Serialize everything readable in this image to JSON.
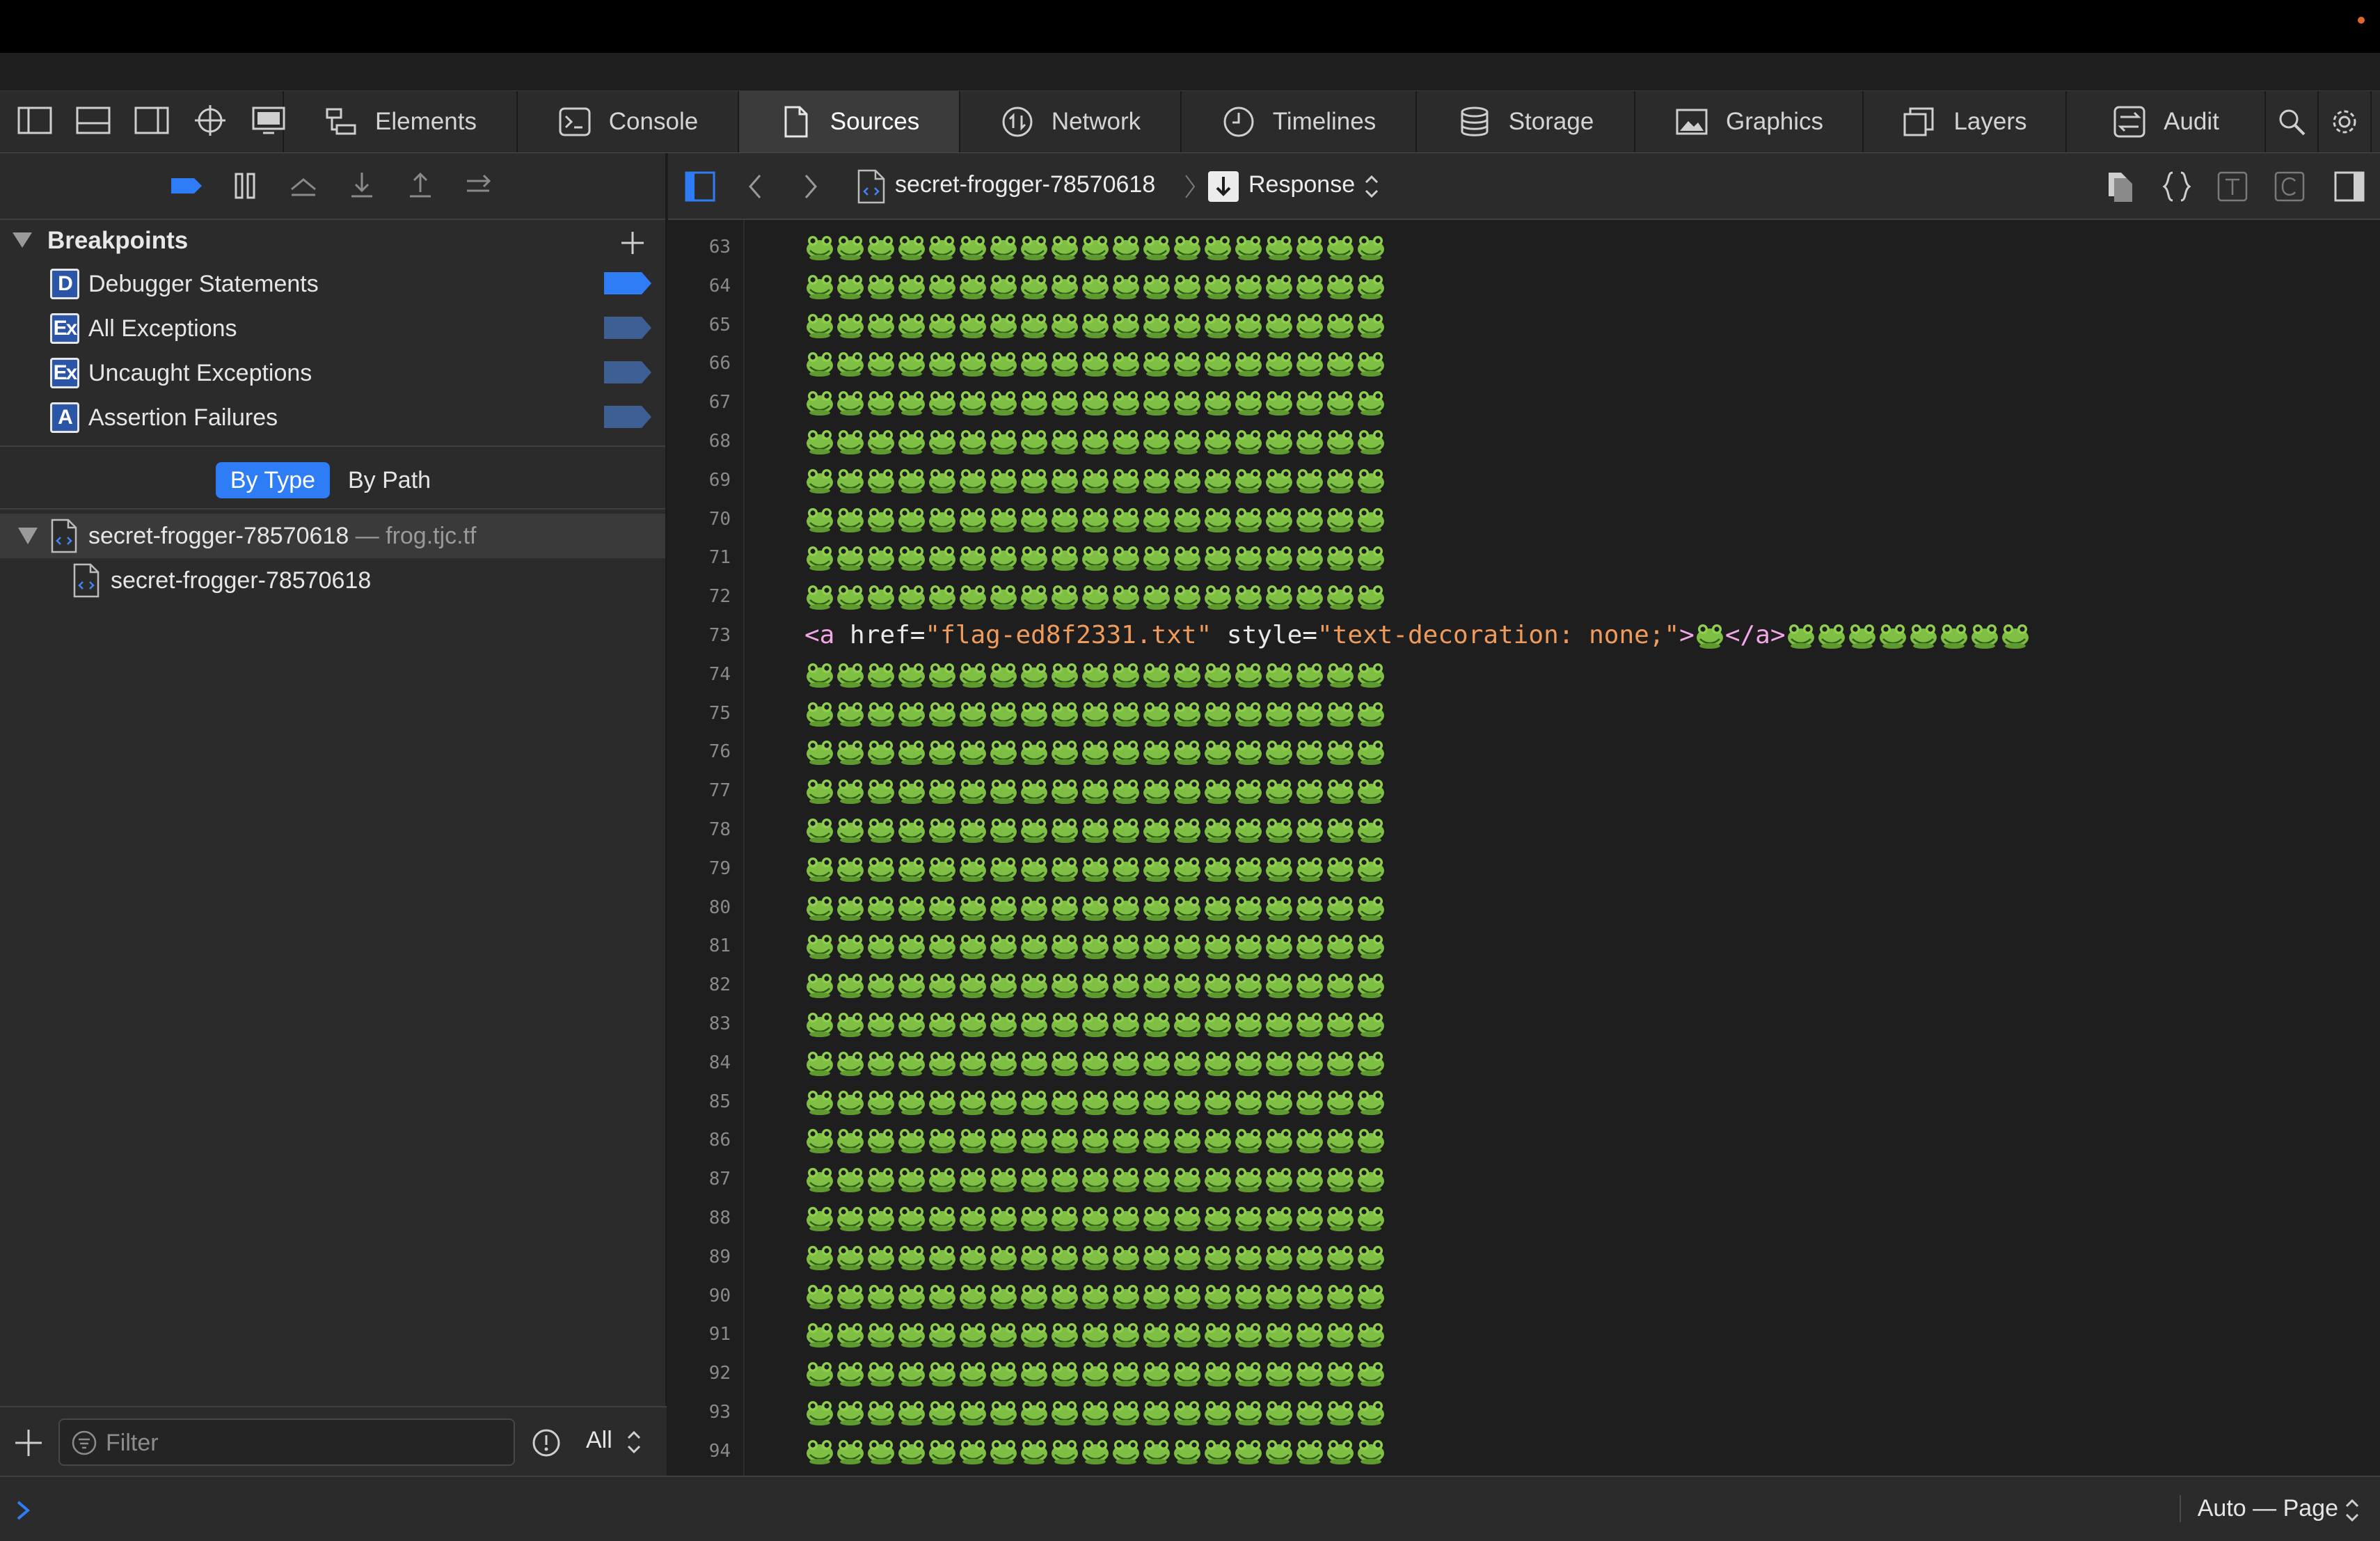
{
  "tabs": [
    {
      "label": "Elements",
      "icon": "elements-icon"
    },
    {
      "label": "Console",
      "icon": "console-icon"
    },
    {
      "label": "Sources",
      "icon": "sources-icon",
      "active": true
    },
    {
      "label": "Network",
      "icon": "network-icon"
    },
    {
      "label": "Timelines",
      "icon": "timelines-icon"
    },
    {
      "label": "Storage",
      "icon": "storage-icon"
    },
    {
      "label": "Graphics",
      "icon": "graphics-icon"
    },
    {
      "label": "Layers",
      "icon": "layers-icon"
    },
    {
      "label": "Audit",
      "icon": "audit-icon"
    }
  ],
  "sidebar": {
    "breakpoints_title": "Breakpoints",
    "breakpoints": [
      {
        "badge": "D",
        "label": "Debugger Statements",
        "enabled": true
      },
      {
        "badge": "Ex",
        "label": "All Exceptions",
        "enabled": false
      },
      {
        "badge": "Ex",
        "label": "Uncaught Exceptions",
        "enabled": false
      },
      {
        "badge": "A",
        "label": "Assertion Failures",
        "enabled": false
      }
    ],
    "view_modes": {
      "selected": "By Type",
      "other": "By Path"
    },
    "tree": {
      "resource": "secret-frogger-78570618",
      "domain": "— frog.tjc.tf",
      "child": "secret-frogger-78570618"
    },
    "filter": {
      "placeholder": "Filter",
      "scope": "All"
    }
  },
  "navbar": {
    "file": "secret-frogger-78570618",
    "mode": "Response"
  },
  "code": {
    "first_line": 63,
    "last_line": 94,
    "frog_char": "🐸",
    "frogs_per_line": 19,
    "special_line": {
      "number": 73,
      "tag_open": "<a",
      "href_attr": "href=",
      "href_value": "\"flag-ed8f2331.txt\"",
      "style_attr": "style=",
      "style_value": "\"text-decoration: none;\"",
      "tag_close_open": ">",
      "tag_end": "</a>",
      "inner_frogs": 1,
      "trailing_frogs": 8
    }
  },
  "bottom": {
    "context": "Auto — Page"
  },
  "colors": {
    "accent": "#2f7df6",
    "tag": "#f2a7e6",
    "string": "#ef9b5c",
    "background": "#1e1e1e",
    "panel": "#2b2b2b"
  }
}
